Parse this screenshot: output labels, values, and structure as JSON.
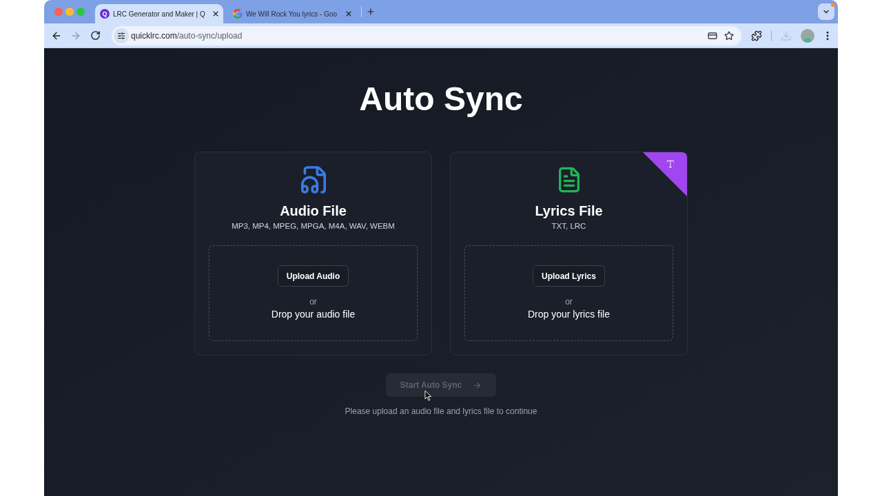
{
  "browser": {
    "tabs": [
      {
        "title": "LRC Generator and Maker | Q",
        "selected": true,
        "favicon": {
          "kind": "letter",
          "text": "Q"
        }
      },
      {
        "title": "We Will Rock You lyrics - Goo",
        "selected": false,
        "favicon": {
          "kind": "g"
        }
      }
    ],
    "address": {
      "host": "quicklrc.com",
      "path": "/auto-sync/upload"
    }
  },
  "page": {
    "title": "Auto Sync",
    "cards": [
      {
        "kind": "audio",
        "title": "Audio File",
        "formats": "MP3, MP4, MPEG, MPGA, M4A, WAV, WEBM",
        "button": "Upload Audio",
        "separator": "or",
        "drop_text": "Drop your audio file",
        "corner_badge": false
      },
      {
        "kind": "lyrics",
        "title": "Lyrics File",
        "formats": "TXT, LRC",
        "button": "Upload Lyrics",
        "separator": "or",
        "drop_text": "Drop your lyrics file",
        "corner_badge": true
      }
    ],
    "start_button": {
      "label": "Start Auto Sync",
      "disabled": true
    },
    "hint": "Please upload an audio file and lyrics file to continue"
  }
}
